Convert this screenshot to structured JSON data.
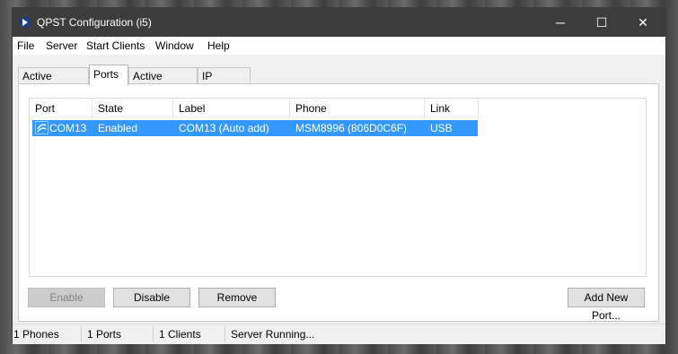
{
  "window": {
    "title": "QPST Configuration (i5)"
  },
  "title_buttons": {
    "minimize": "─",
    "maximize": "☐",
    "close": "✕"
  },
  "menu": [
    "File",
    "Server",
    "Start Clients",
    "Window",
    "Help"
  ],
  "tabs": [
    "Active Phones",
    "Ports",
    "Active Clients",
    "IP Server"
  ],
  "active_tab": "Ports",
  "table": {
    "columns": [
      "Port",
      "State",
      "Label",
      "Phone",
      "Link"
    ],
    "rows": [
      {
        "port": "COM13",
        "state": "Enabled",
        "label": "COM13 (Auto add)",
        "phone": "MSM8996 (806D0C6F)",
        "link": "USB",
        "selected": true
      }
    ]
  },
  "buttons": {
    "enable": "Enable",
    "disable": "Disable",
    "remove": "Remove",
    "add_new_port": "Add New Port..."
  },
  "status": [
    "1 Phones",
    "1 Ports",
    "1 Clients",
    "Server Running..."
  ],
  "colors": {
    "selection": "#3399ff",
    "titlebar": "#3c3c3c"
  }
}
